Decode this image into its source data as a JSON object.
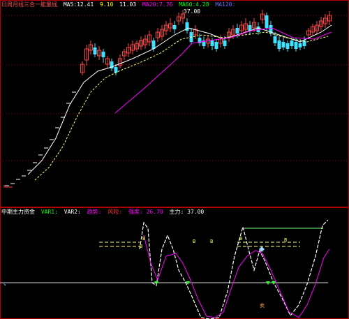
{
  "colors": {
    "background": "#000000",
    "frame": "#b00000",
    "grid": "#8a0000",
    "up": "#ff4040",
    "down": "#40e0ff",
    "ma_white": "#ffffff",
    "ma_yellow": "#ffff00",
    "ma_magenta": "#ff00ff",
    "ma_green": "#00ff00",
    "ma_blue": "#6a6aff",
    "separator": "#ff3030"
  },
  "main_header": {
    "title": "日周月线三合一能量线",
    "items": [
      {
        "text": "MA5:12.41",
        "color": "#ffffff"
      },
      {
        "text": "9.10",
        "color": "#ffff00"
      },
      {
        "text": "11.03",
        "color": "#ffffff"
      },
      {
        "text": "MA20:7.76",
        "color": "#ff00ff"
      },
      {
        "text": "MA60:4.28",
        "color": "#00ff00"
      },
      {
        "text": "MA120:",
        "color": "#6a6aff"
      }
    ]
  },
  "main_chart": {
    "high_label": "37.00",
    "candles": [
      [
        0,
        0,
        0,
        0
      ],
      [
        0,
        0,
        0,
        0
      ]
    ]
  },
  "indicator_header": {
    "items": [
      {
        "text": "中期主力资金",
        "color": "#ffffff"
      },
      {
        "text": "VAR1:",
        "color": "#00ff00"
      },
      {
        "text": "VAR2:",
        "color": "#ffffff"
      },
      {
        "text": "趋势:",
        "color": "#ff00ff"
      },
      {
        "text": "风险:",
        "color": "#ff0000"
      },
      {
        "text": "强度: 26.70",
        "color": "#ff00ff"
      },
      {
        "text": "主力: 37.00",
        "color": "#ffffff"
      }
    ]
  },
  "indicator": {
    "signals": [
      "B",
      "B",
      "B",
      "B",
      "B",
      "B",
      "卖"
    ]
  }
}
